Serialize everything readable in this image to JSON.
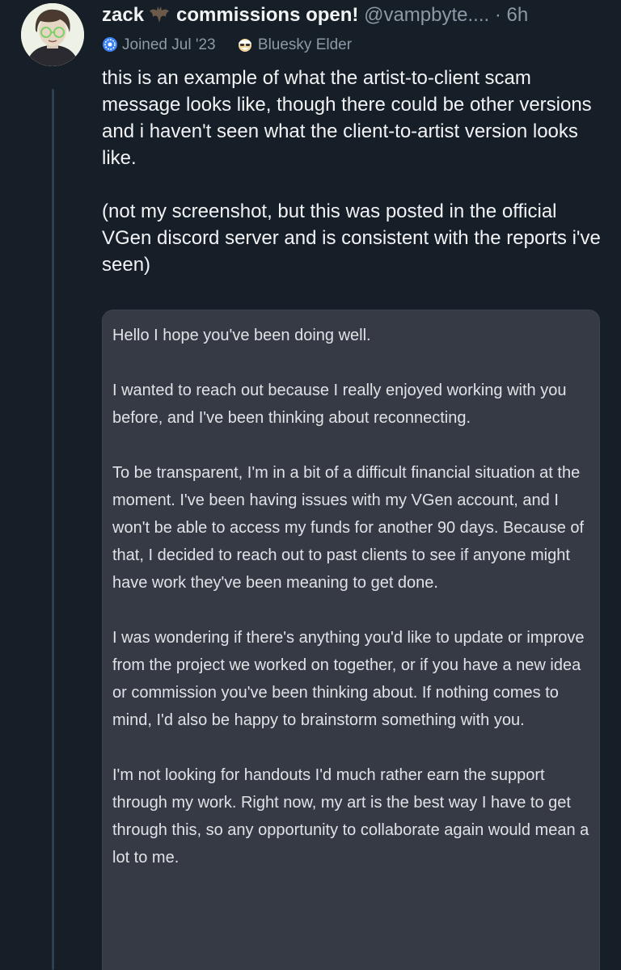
{
  "post": {
    "display_name": "zack",
    "display_name_suffix": "commissions open!",
    "handle": "@vampbyte....",
    "separator": "·",
    "time": "6h",
    "badges": [
      {
        "icon": "starburst-badge-icon",
        "label": "Joined Jul '23"
      },
      {
        "icon": "elder-face-icon",
        "label": "Bluesky Elder"
      }
    ],
    "text_paragraphs": [
      "this is an example of what the artist-to-client scam message looks like, though there could be other versions and i haven't seen what the client-to-artist version looks like.",
      "(not my screenshot, but this was posted in the official VGen discord server and is consistent with the reports i've seen)"
    ]
  },
  "embed": {
    "paragraphs": [
      "Hello I hope you've been doing well.",
      "I wanted to reach out because I really enjoyed working with you before, and I've been thinking about reconnecting.",
      "To be transparent, I'm in a bit of a difficult financial situation at the moment. I've been having issues with my VGen account, and I won't be able to access my funds for another 90 days. Because of that, I decided to reach out to past clients to see if anyone might have work they've been meaning to get done.",
      "I was wondering if there's anything you'd like to update or improve from the project we worked on together, or if you have a new idea or commission you've been thinking about. If nothing comes to mind, I'd also be happy to brainstorm something with you.",
      "I'm not looking for handouts I'd much rather earn the support through my work. Right now, my art is the best way I have to get through this, so any opportunity to collaborate again would mean a lot to me."
    ]
  },
  "colors": {
    "background": "#161e27",
    "text": "#f1f3f5",
    "muted": "#8d99a6",
    "embed_background": "#363a44",
    "badge_blue": "#3b82f6"
  }
}
